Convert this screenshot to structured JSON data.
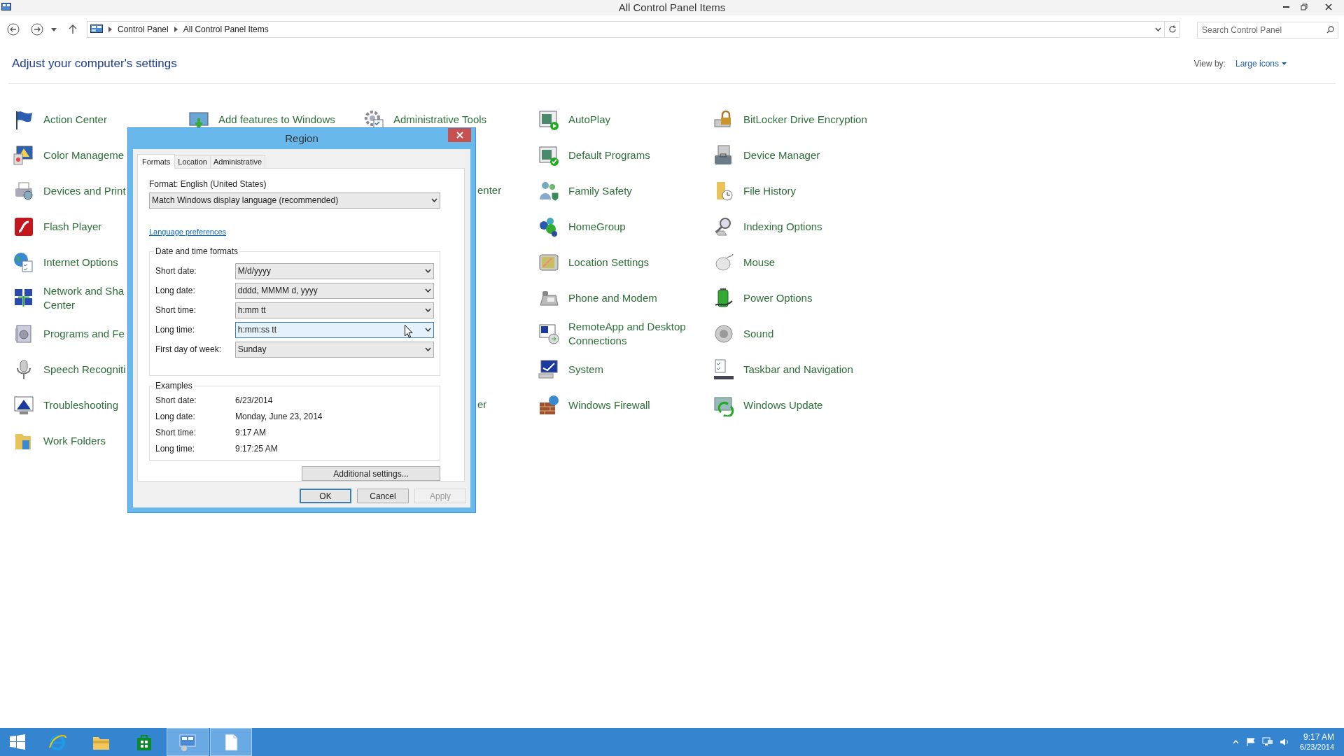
{
  "window": {
    "title": "All Control Panel Items"
  },
  "address_bar": {
    "breadcrumbs": [
      "Control Panel",
      "All Control Panel Items"
    ]
  },
  "search": {
    "placeholder": "Search Control Panel"
  },
  "heading": "Adjust your computer's settings",
  "view_by": {
    "label": "View by:",
    "value": "Large icons"
  },
  "rows": [
    {
      "cells": [
        {
          "kind": "item",
          "text": "Action Center"
        },
        {
          "kind": "item",
          "text": "Add features to Windows"
        },
        {
          "kind": "item",
          "text": "Administrative Tools"
        },
        {
          "kind": "item",
          "text": "AutoPlay"
        },
        {
          "kind": "item",
          "text": "BitLocker Drive Encryption"
        }
      ]
    },
    {
      "cells": [
        {
          "kind": "item",
          "text": "Color Manageme"
        },
        {
          "kind": "covered"
        },
        {
          "kind": "covered"
        },
        {
          "kind": "item",
          "text": "Default Programs"
        },
        {
          "kind": "item",
          "text": "Device Manager"
        }
      ]
    },
    {
      "cells": [
        {
          "kind": "item",
          "text": "Devices and Print"
        },
        {
          "kind": "covered"
        },
        {
          "kind": "clipped",
          "text": "enter"
        },
        {
          "kind": "item",
          "text": "Family Safety"
        },
        {
          "kind": "item",
          "text": "File History"
        }
      ]
    },
    {
      "cells": [
        {
          "kind": "item",
          "text": "Flash Player"
        },
        {
          "kind": "covered"
        },
        {
          "kind": "covered"
        },
        {
          "kind": "item",
          "text": "HomeGroup"
        },
        {
          "kind": "item",
          "text": "Indexing Options"
        }
      ]
    },
    {
      "cells": [
        {
          "kind": "item",
          "text": "Internet Options"
        },
        {
          "kind": "covered"
        },
        {
          "kind": "covered"
        },
        {
          "kind": "item",
          "text": "Location Settings"
        },
        {
          "kind": "item",
          "text": "Mouse"
        }
      ]
    },
    {
      "cells": [
        {
          "kind": "item",
          "text": "Network and Sha Center"
        },
        {
          "kind": "covered"
        },
        {
          "kind": "covered"
        },
        {
          "kind": "item",
          "text": "Phone and Modem"
        },
        {
          "kind": "item",
          "text": "Power Options"
        }
      ]
    },
    {
      "cells": [
        {
          "kind": "item",
          "text": "Programs and Fe"
        },
        {
          "kind": "covered"
        },
        {
          "kind": "covered"
        },
        {
          "kind": "item",
          "text": "RemoteApp and Desktop Connections"
        },
        {
          "kind": "item",
          "text": "Sound"
        }
      ]
    },
    {
      "cells": [
        {
          "kind": "item",
          "text": "Speech Recogniti"
        },
        {
          "kind": "covered"
        },
        {
          "kind": "covered"
        },
        {
          "kind": "item",
          "text": "System"
        },
        {
          "kind": "item",
          "text": "Taskbar and Navigation"
        }
      ]
    },
    {
      "cells": [
        {
          "kind": "item",
          "text": "Troubleshooting"
        },
        {
          "kind": "covered"
        },
        {
          "kind": "clipped",
          "text": "er"
        },
        {
          "kind": "item",
          "text": "Windows Firewall"
        },
        {
          "kind": "item",
          "text": "Windows Update"
        }
      ]
    },
    {
      "cells": [
        {
          "kind": "item",
          "text": "Work Folders"
        }
      ]
    }
  ],
  "dialog": {
    "title": "Region",
    "tabs": [
      {
        "label": "Formats",
        "selected": true
      },
      {
        "label": "Location",
        "selected": false
      },
      {
        "label": "Administrative",
        "selected": false
      }
    ],
    "format_label": "Format: English (United States)",
    "format_dropdown": "Match Windows display language (recommended)",
    "link": "Language preferences",
    "formats_group": {
      "title": "Date and time formats",
      "rows": [
        {
          "label": "Short date:",
          "value": "M/d/yyyy",
          "hovered": false
        },
        {
          "label": "Long date:",
          "value": "dddd, MMMM d, yyyy",
          "hovered": false
        },
        {
          "label": "Short time:",
          "value": "h:mm tt",
          "hovered": false
        },
        {
          "label": "Long time:",
          "value": "h:mm:ss tt",
          "hovered": true
        },
        {
          "label": "First day of week:",
          "value": "Sunday",
          "hovered": false
        }
      ]
    },
    "examples": {
      "title": "Examples",
      "rows": [
        {
          "label": "Short date:",
          "value": "6/23/2014"
        },
        {
          "label": "Long date:",
          "value": "Monday, June 23, 2014"
        },
        {
          "label": "Short time:",
          "value": "9:17 AM"
        },
        {
          "label": "Long time:",
          "value": "9:17:25 AM"
        }
      ]
    },
    "additional_button": "Additional settings...",
    "buttons": [
      {
        "label": "OK",
        "default": true,
        "disabled": false
      },
      {
        "label": "Cancel",
        "default": false,
        "disabled": false
      },
      {
        "label": "Apply",
        "default": false,
        "disabled": true
      }
    ]
  },
  "taskbar": {
    "apps": [
      {
        "active": false
      },
      {
        "active": false
      },
      {
        "active": false
      },
      {
        "active": true
      },
      {
        "active": true
      }
    ],
    "clock": {
      "time": "9:17 AM",
      "date": "6/23/2014"
    }
  }
}
